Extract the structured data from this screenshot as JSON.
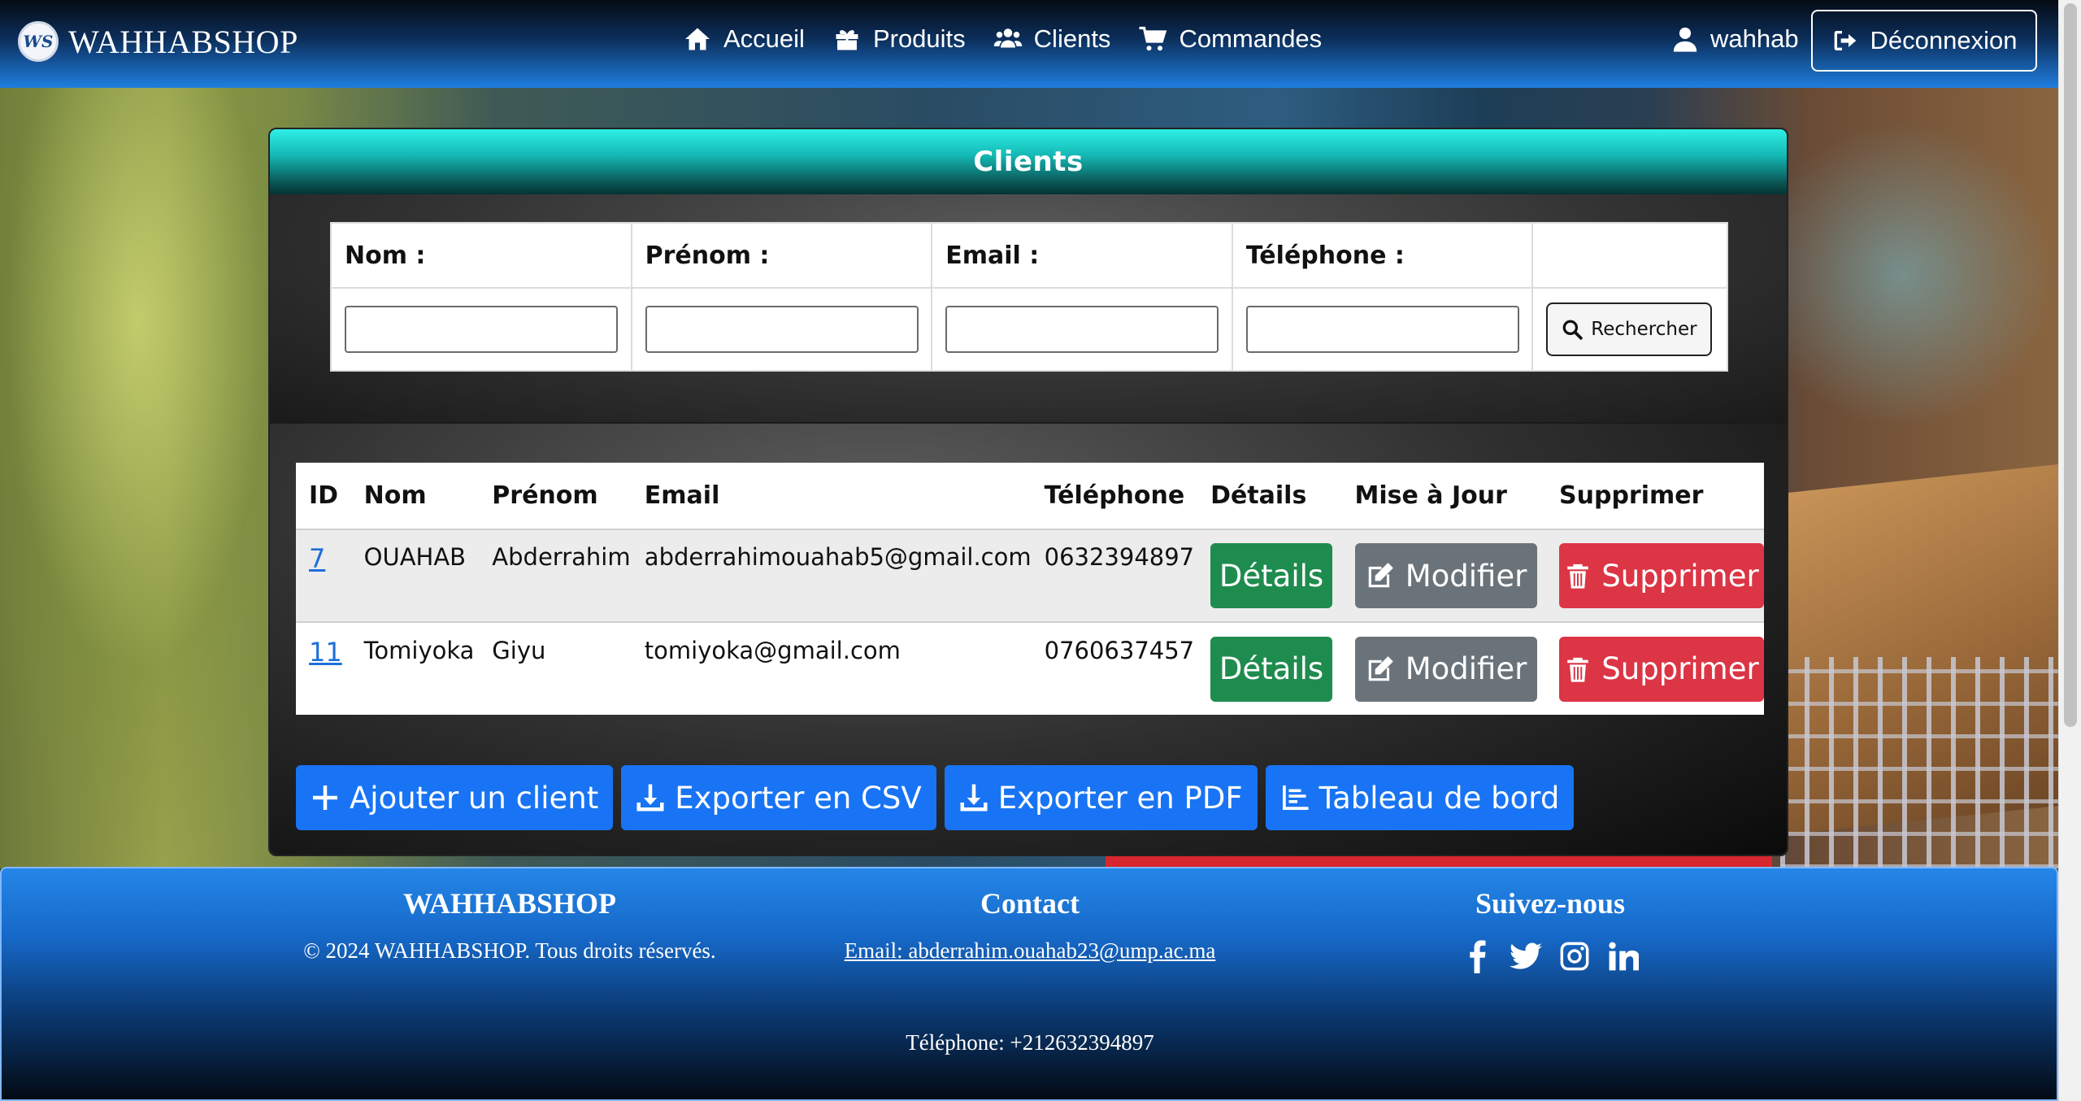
{
  "navbar": {
    "brand": "WAHHABSHOP",
    "links": [
      {
        "label": "Accueil",
        "icon": "home-icon"
      },
      {
        "label": "Produits",
        "icon": "gift-icon"
      },
      {
        "label": "Clients",
        "icon": "users-icon"
      },
      {
        "label": "Commandes",
        "icon": "cart-icon"
      }
    ],
    "username": "wahhab",
    "logout_label": "Déconnexion"
  },
  "card": {
    "title": "Clients"
  },
  "search": {
    "headers": [
      "Nom :",
      "Prénom :",
      "Email :",
      "Téléphone :"
    ],
    "values": [
      "",
      "",
      "",
      ""
    ],
    "button_label": "Rechercher"
  },
  "table": {
    "headers": [
      "ID",
      "Nom",
      "Prénom",
      "Email",
      "Téléphone",
      "Détails",
      "Mise à Jour",
      "Supprimer"
    ],
    "rows": [
      {
        "id": "7",
        "nom": "OUAHAB",
        "prenom": "Abderrahim",
        "email": "abderrahimouahab5@gmail.com",
        "telephone": "0632394897"
      },
      {
        "id": "11",
        "nom": "Tomiyoka",
        "prenom": "Giyu",
        "email": "tomiyoka@gmail.com",
        "telephone": "0760637457"
      }
    ],
    "details_label": "Détails",
    "modify_label": "Modifier",
    "delete_label": "Supprimer"
  },
  "actions": {
    "add_label": "Ajouter un client",
    "csv_label": "Exporter en CSV",
    "pdf_label": "Exporter en PDF",
    "dashboard_label": "Tableau de bord"
  },
  "footer": {
    "brand_title": "WAHHABSHOP",
    "copyright": "© 2024 WAHHABSHOP. Tous droits réservés.",
    "contact_title": "Contact",
    "contact_email": "Email: abderrahim.ouahab23@ump.ac.ma",
    "contact_phone": "Téléphone: +212632394897",
    "social_title": "Suivez-nous",
    "social_icons": [
      "facebook-icon",
      "twitter-icon",
      "instagram-icon",
      "linkedin-icon"
    ]
  },
  "colors": {
    "primary_blue": "#1874f4",
    "success": "#1e8c4e",
    "secondary": "#6b737a",
    "danger": "#dc3545",
    "header_teal": "#14b8b4"
  }
}
